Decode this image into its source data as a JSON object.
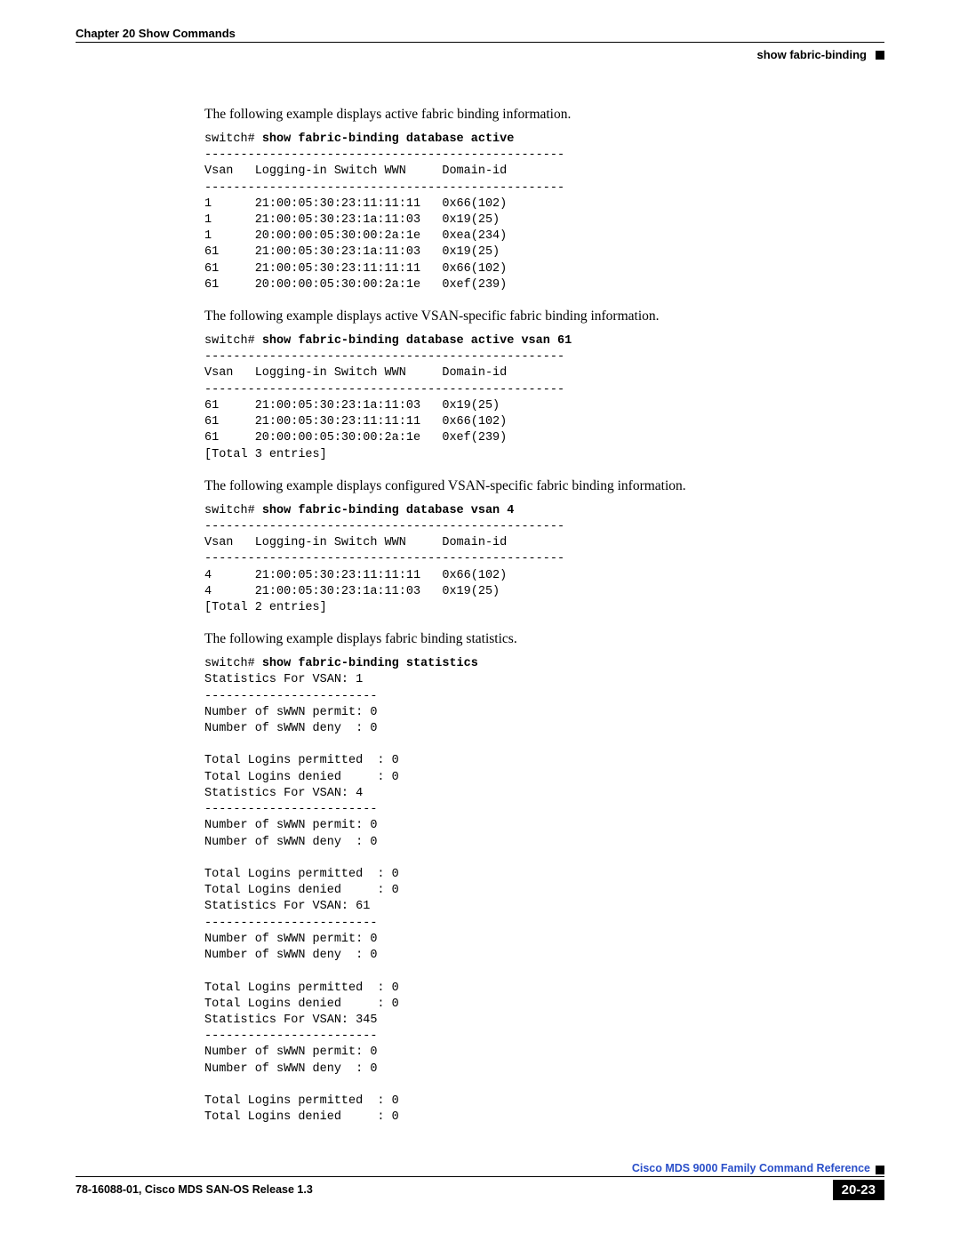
{
  "header": {
    "chapter": "Chapter 20    Show Commands",
    "section": "show fabric-binding"
  },
  "blocks": [
    {
      "intro": "The following example displays active fabric binding information.",
      "prompt": "switch# ",
      "command": "show fabric-binding database active",
      "output": "--------------------------------------------------\nVsan   Logging-in Switch WWN     Domain-id\n--------------------------------------------------\n1      21:00:05:30:23:11:11:11   0x66(102)\n1      21:00:05:30:23:1a:11:03   0x19(25)\n1      20:00:00:05:30:00:2a:1e   0xea(234)\n61     21:00:05:30:23:1a:11:03   0x19(25)\n61     21:00:05:30:23:11:11:11   0x66(102)\n61     20:00:00:05:30:00:2a:1e   0xef(239)"
    },
    {
      "intro": "The following example displays active VSAN-specific fabric binding information.",
      "prompt": "switch# ",
      "command": "show fabric-binding database active vsan 61",
      "output": "--------------------------------------------------\nVsan   Logging-in Switch WWN     Domain-id\n--------------------------------------------------\n61     21:00:05:30:23:1a:11:03   0x19(25)\n61     21:00:05:30:23:11:11:11   0x66(102)\n61     20:00:00:05:30:00:2a:1e   0xef(239)\n[Total 3 entries]"
    },
    {
      "intro": "The following example displays configured VSAN-specific fabric binding information.",
      "prompt": "switch# ",
      "command": "show fabric-binding database vsan 4",
      "output": "--------------------------------------------------\nVsan   Logging-in Switch WWN     Domain-id\n--------------------------------------------------\n4      21:00:05:30:23:11:11:11   0x66(102)\n4      21:00:05:30:23:1a:11:03   0x19(25)\n[Total 2 entries]"
    },
    {
      "intro": "The following example displays fabric binding statistics.",
      "prompt": "switch# ",
      "command": "show fabric-binding statistics",
      "output": "Statistics For VSAN: 1\n------------------------\nNumber of sWWN permit: 0\nNumber of sWWN deny  : 0\n\nTotal Logins permitted  : 0\nTotal Logins denied     : 0\nStatistics For VSAN: 4\n------------------------\nNumber of sWWN permit: 0\nNumber of sWWN deny  : 0\n\nTotal Logins permitted  : 0\nTotal Logins denied     : 0\nStatistics For VSAN: 61\n------------------------\nNumber of sWWN permit: 0\nNumber of sWWN deny  : 0\n\nTotal Logins permitted  : 0\nTotal Logins denied     : 0\nStatistics For VSAN: 345\n------------------------\nNumber of sWWN permit: 0\nNumber of sWWN deny  : 0\n\nTotal Logins permitted  : 0\nTotal Logins denied     : 0"
    }
  ],
  "footer": {
    "title": "Cisco MDS 9000 Family Command Reference",
    "release": "78-16088-01, Cisco MDS SAN-OS Release 1.3",
    "page": "20-23"
  }
}
